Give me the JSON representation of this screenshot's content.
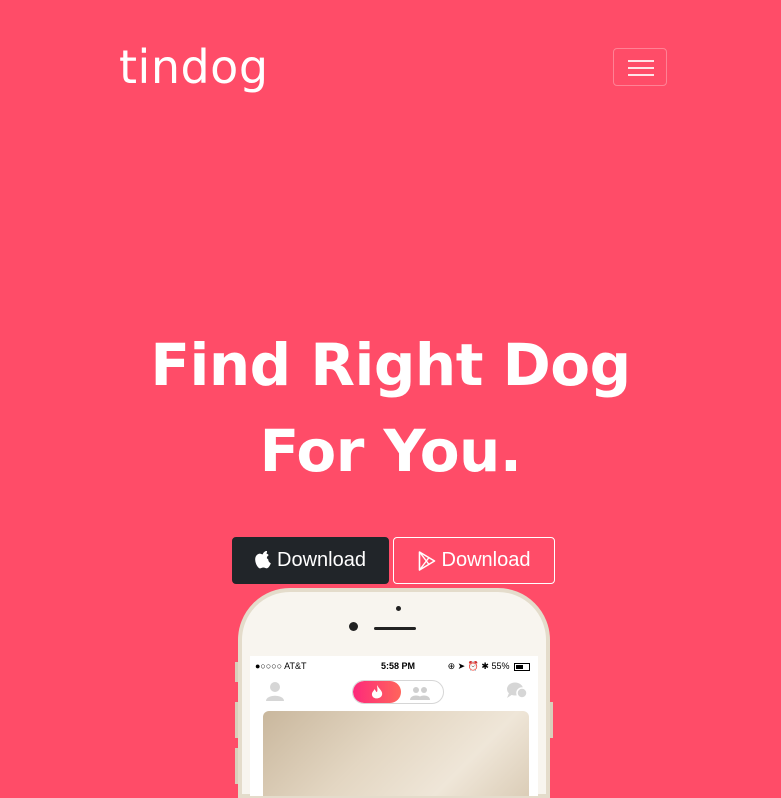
{
  "navbar": {
    "brand": "tindog",
    "toggler_icon": "hamburger-icon"
  },
  "hero": {
    "title_line1": "Find Right Dog",
    "title_line2": "For You.",
    "buttons": [
      {
        "label": "Download",
        "icon": "apple-icon",
        "style": "dark"
      },
      {
        "label": "Download",
        "icon": "google-play-icon",
        "style": "outline"
      }
    ]
  },
  "phone": {
    "status": {
      "carrier": "●○○○○ AT&T",
      "time": "5:58 PM",
      "battery": "55%"
    }
  },
  "colors": {
    "background": "#ff4c68",
    "button_dark": "#212529",
    "accent_gradient_start": "#fd297b",
    "accent_gradient_end": "#ff655b"
  }
}
